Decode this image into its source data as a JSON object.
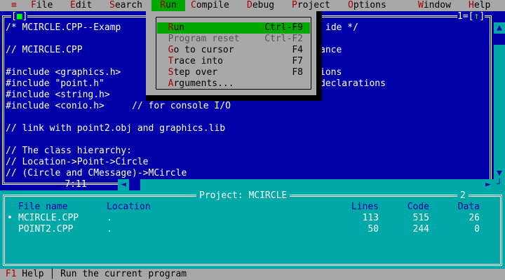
{
  "menubar": {
    "system": "≡",
    "items": [
      "File",
      "Edit",
      "Search",
      "Run",
      "Compile",
      "Debug",
      "Project",
      "Options",
      "Window",
      "Help"
    ],
    "hotkeys": [
      "F",
      "E",
      "S",
      "R",
      "C",
      "D",
      "P",
      "O",
      "W",
      "H"
    ]
  },
  "editor": {
    "close_box": "[■]",
    "window_num": "1",
    "zoom_box": "[↑]",
    "cursor_pos": "7:11",
    "lines": [
      "/* MCIRCLE.CPP--Examp",
      "",
      "// MCIRCLE.CPP",
      "",
      "#include <graphics.h>",
      "#include \"point.h\"",
      "#include <string.h>",
      "#include <conio.h>     // for console I/O",
      "",
      "// link with point2.obj and graphics.lib",
      "",
      "// The class hierarchy:",
      "// Location->Point->Circle",
      "// (Circle and CMessage)->MCircle"
    ],
    "right_fragments": {
      "line0": "ide */",
      "line2": "ance",
      "line4": "ions",
      "line5": "declarations"
    }
  },
  "run_menu": {
    "items": [
      {
        "label": "Run",
        "hotkey": "R",
        "rest": "un",
        "shortcut": "Ctrl-F9",
        "selected": true,
        "disabled": false
      },
      {
        "label": "Program reset",
        "hotkey": "",
        "rest": "Program reset",
        "shortcut": "Ctrl-F2",
        "selected": false,
        "disabled": true
      },
      {
        "label": "Go to cursor",
        "hotkey": "G",
        "rest": "o to cursor",
        "shortcut": "F4",
        "selected": false,
        "disabled": false
      },
      {
        "label": "Trace into",
        "hotkey": "T",
        "rest": "race into",
        "shortcut": "F7",
        "selected": false,
        "disabled": false
      },
      {
        "label": "Step over",
        "hotkey": "S",
        "rest": "tep over",
        "shortcut": "F8",
        "selected": false,
        "disabled": false
      },
      {
        "label": "Arguments...",
        "hotkey": "A",
        "rest": "rguments...",
        "shortcut": "",
        "selected": false,
        "disabled": false
      }
    ]
  },
  "project": {
    "title": "Project: MCIRCLE",
    "window_num": "2",
    "headers": {
      "file": "File name",
      "location": "Location",
      "lines": "Lines",
      "code": "Code",
      "data": "Data"
    },
    "rows": [
      {
        "marker": "•",
        "file": "MCIRCLE.CPP",
        "location": ".",
        "lines": "113",
        "code": "515",
        "data": "26"
      },
      {
        "marker": "",
        "file": "POINT2.CPP",
        "location": ".",
        "lines": "50",
        "code": "244",
        "data": "0"
      }
    ]
  },
  "status": {
    "key": "F1",
    "key_label": " Help",
    "separator": "│",
    "message": " Run the current program"
  },
  "colors": {
    "desktop_blue": "#0000a8",
    "menu_gray": "#a8a8a8",
    "highlight_green": "#00a800",
    "hotkey_red": "#a80000",
    "cyan": "#00a8a8"
  }
}
